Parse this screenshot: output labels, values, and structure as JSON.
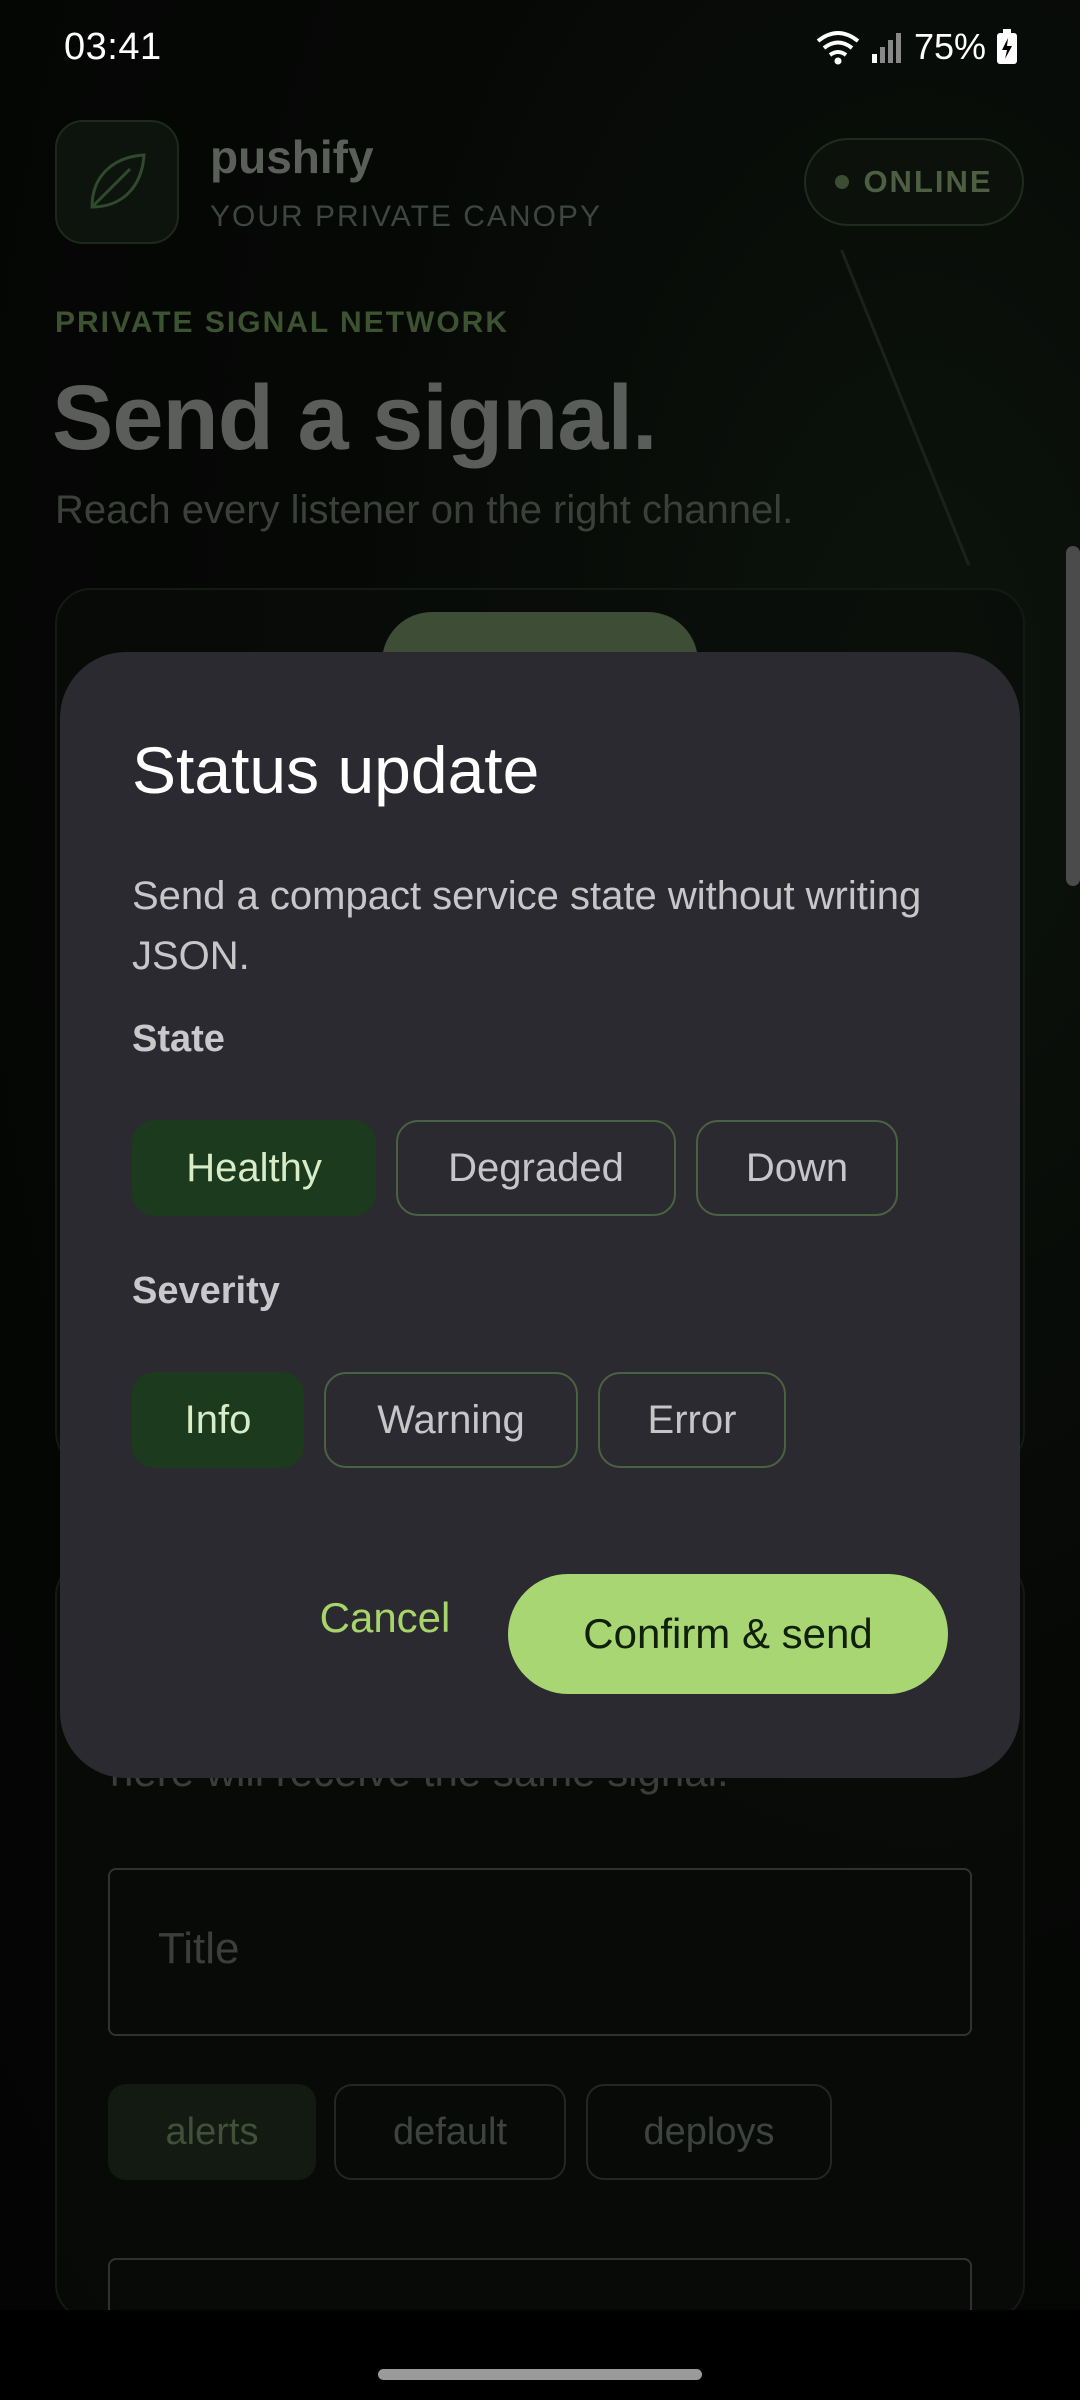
{
  "status_bar": {
    "time": "03:41",
    "battery": "75%",
    "icons": [
      "wifi-icon",
      "signal-icon",
      "battery-charging-icon"
    ]
  },
  "app": {
    "name": "pushify",
    "tagline": "YOUR PRIVATE CANOPY",
    "status_badge": "ONLINE",
    "eyebrow": "PRIVATE SIGNAL NETWORK",
    "hero_title": "Send a signal.",
    "hero_subtitle": "Reach every listener on the right channel.",
    "hint_text": "here will receive the same signal.",
    "title_placeholder": "Title",
    "channels": [
      {
        "label": "alerts",
        "selected": true
      },
      {
        "label": "default",
        "selected": false
      },
      {
        "label": "deploys",
        "selected": false
      }
    ]
  },
  "dialog": {
    "title": "Status update",
    "description": "Send a compact service state without writing JSON.",
    "state_label": "State",
    "states": [
      {
        "label": "Healthy",
        "selected": true
      },
      {
        "label": "Degraded",
        "selected": false
      },
      {
        "label": "Down",
        "selected": false
      }
    ],
    "severity_label": "Severity",
    "severities": [
      {
        "label": "Info",
        "selected": true
      },
      {
        "label": "Warning",
        "selected": false
      },
      {
        "label": "Error",
        "selected": false
      }
    ],
    "cancel_label": "Cancel",
    "confirm_label": "Confirm & send"
  },
  "colors": {
    "accent": "#a8d673",
    "selected_chip": "#1c3a1d",
    "dialog_bg": "#2b2a30"
  }
}
